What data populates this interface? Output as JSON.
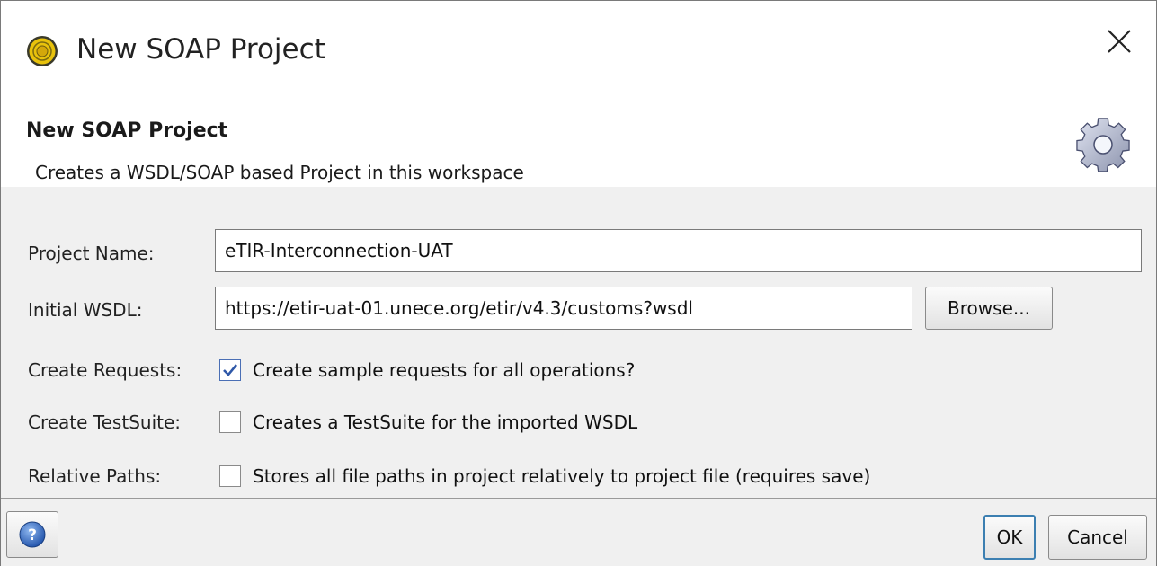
{
  "window": {
    "title": "New SOAP Project",
    "close_icon": "close-icon"
  },
  "header": {
    "title": "New SOAP Project",
    "description": "Creates a WSDL/SOAP based Project in this workspace",
    "icon": "gear-icon"
  },
  "form": {
    "project_name": {
      "label": "Project Name:",
      "value": "eTIR-Interconnection-UAT"
    },
    "initial_wsdl": {
      "label": "Initial WSDL:",
      "value": "https://etir-uat-01.unece.org/etir/v4.3/customs?wsdl",
      "browse_label": "Browse..."
    },
    "create_requests": {
      "label": "Create Requests:",
      "checkbox_label": "Create sample requests for all operations?",
      "checked": true
    },
    "create_testsuite": {
      "label": "Create TestSuite:",
      "checkbox_label": "Creates a TestSuite for the imported WSDL",
      "checked": false
    },
    "relative_paths": {
      "label": "Relative Paths:",
      "checkbox_label": "Stores all file paths in project relatively to project file (requires save)",
      "checked": false
    }
  },
  "footer": {
    "help_icon": "help-icon",
    "ok_label": "OK",
    "cancel_label": "Cancel"
  }
}
